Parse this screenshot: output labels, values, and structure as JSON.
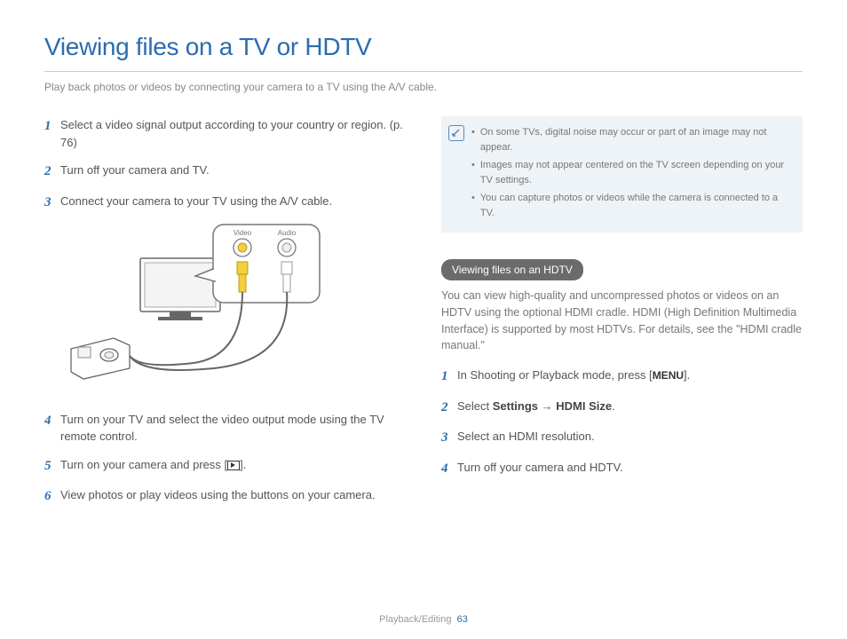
{
  "title": "Viewing files on a TV or HDTV",
  "subtitle": "Play back photos or videos by connecting your camera to a TV using the A/V cable.",
  "left_steps": [
    {
      "num": "1",
      "text": "Select a video signal output according to your country or region. (p. 76)"
    },
    {
      "num": "2",
      "text": "Turn off your camera and TV."
    },
    {
      "num": "3",
      "text": "Connect your camera to your TV using the A/V cable."
    },
    {
      "num": "4",
      "text": "Turn on your TV and select the video output mode using the TV remote control."
    },
    {
      "num": "5",
      "pre": "Turn on your camera and press [",
      "post": "]."
    },
    {
      "num": "6",
      "text": "View photos or play videos using the buttons on your camera."
    }
  ],
  "diagram_labels": {
    "video": "Video",
    "audio": "Audio"
  },
  "notes": [
    "On some TVs, digital noise may occur or part of an image may not appear.",
    "Images may not appear centered on the TV screen depending on your TV settings.",
    "You can capture photos or videos while the camera is connected to a TV."
  ],
  "hdtv_section": {
    "pill": "Viewing files on an HDTV",
    "intro": "You can view high-quality and uncompressed photos or videos on an HDTV using the optional HDMI cradle. HDMI (High Definition Multimedia Interface) is supported by most HDTVs. For details, see the \"HDMI cradle manual.\"",
    "steps": [
      {
        "num": "1",
        "pre": "In Shooting or Playback mode, press [",
        "menu": "MENU",
        "post": "]."
      },
      {
        "num": "2",
        "pre": "Select ",
        "b1": "Settings",
        "arrow": " → ",
        "b2": "HDMI Size",
        "post": "."
      },
      {
        "num": "3",
        "text": "Select an HDMI resolution."
      },
      {
        "num": "4",
        "text": "Turn off your camera and HDTV."
      }
    ]
  },
  "footer": {
    "section": "Playback/Editing",
    "page": "63"
  }
}
